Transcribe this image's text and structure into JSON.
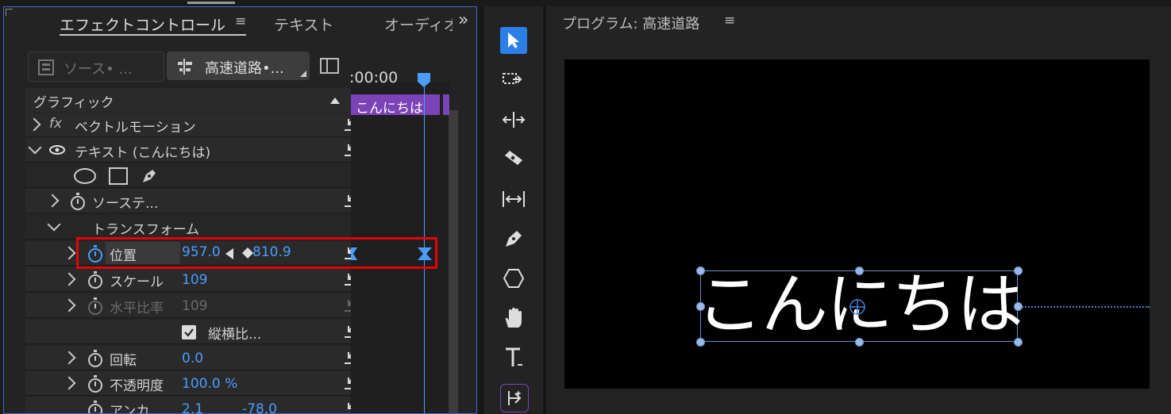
{
  "left_panel": {
    "tabs": {
      "effect_controls": "エフェクトコントロール",
      "text": "テキスト",
      "audio": "オーディオ"
    },
    "more_glyph": "»",
    "source_clip": "ソース• ...",
    "sequence_clip": "高速道路•...",
    "timecode": ":00:00",
    "clip_label": "こんにちは",
    "section_header": "グラフィック",
    "rows": {
      "vector_motion": "ベクトルモーション",
      "fx_glyph": "fx",
      "text_layer": "テキスト (こんにちは)",
      "source_text": "ソーステ...",
      "transform": "トランスフォーム",
      "position_label": "位置",
      "position_x": "957.0",
      "position_y": "810.9",
      "scale_label": "スケール",
      "scale_value": "109",
      "hscale_label": "水平比率",
      "hscale_value": "109",
      "aspect_label": "縦横比...",
      "rotation_label": "回転",
      "rotation_value": "0.0",
      "opacity_label": "不透明度",
      "opacity_value": "100.0 %",
      "anchor_label": "アンカ...",
      "anchor_x": "2.1",
      "anchor_y": "-78.0"
    }
  },
  "program_monitor": {
    "title": "プログラム: 高速道路",
    "canvas_text": "こんにちは"
  },
  "colors": {
    "accent": "#4a9dff",
    "clip_purple": "#7a43b6",
    "highlight_red": "#e8000b",
    "selection_tool": "#2d7fe8"
  },
  "tools": [
    "selection-tool",
    "track-select-tool",
    "ripple-edit-tool",
    "razor-tool",
    "slip-tool",
    "pen-tool",
    "shape-tool",
    "hand-tool",
    "type-tool",
    "remix-tool"
  ]
}
